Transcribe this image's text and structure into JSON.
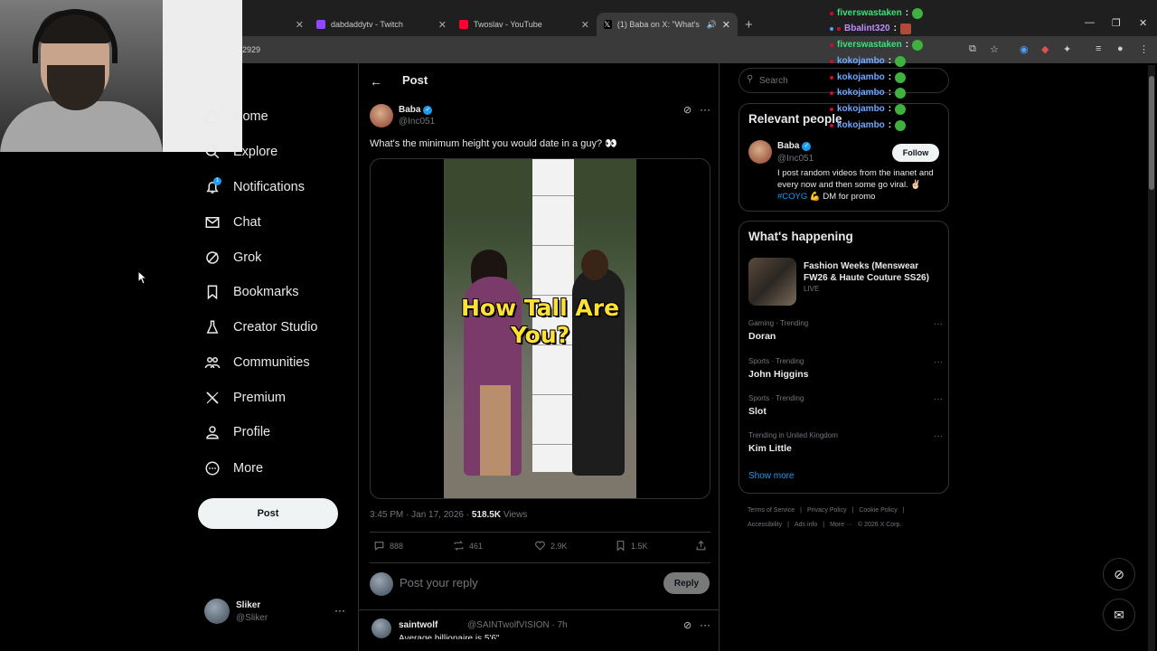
{
  "browser": {
    "tabs": [
      {
        "label": "dabdaddytv - Twitch",
        "color": "#9146ff"
      },
      {
        "label": "Twoslav - YouTube",
        "color": "#ff0033"
      },
      {
        "label": "(1) Baba on X: \"What's the",
        "color": "#ffffff"
      }
    ],
    "url_fragment": "2929"
  },
  "nav": {
    "items": [
      {
        "label": "Home",
        "icon": "home-icon"
      },
      {
        "label": "Explore",
        "icon": "search-icon"
      },
      {
        "label": "Notifications",
        "icon": "bell-icon"
      },
      {
        "label": "Chat",
        "icon": "mail-icon"
      },
      {
        "label": "Grok",
        "icon": "grok-icon"
      },
      {
        "label": "Bookmarks",
        "icon": "bookmark-icon"
      },
      {
        "label": "Creator Studio",
        "icon": "flask-icon"
      },
      {
        "label": "Communities",
        "icon": "people-icon"
      },
      {
        "label": "Premium",
        "icon": "x-logo-icon"
      },
      {
        "label": "Profile",
        "icon": "person-icon"
      },
      {
        "label": "More",
        "icon": "more-circle-icon"
      }
    ],
    "notification_count": "1",
    "post_label": "Post",
    "account": {
      "name": "Sliker",
      "handle": "@Sliker"
    }
  },
  "post": {
    "header": "Post",
    "author": {
      "name": "Baba",
      "handle": "@Inc051"
    },
    "text": "What's the minimum height you would date in a guy? 👀",
    "video_caption": "How Tall Are You?",
    "time": "3:45 PM · Jan 17, 2026 · ",
    "views": "518.5K",
    "views_label": " Views",
    "stats": {
      "replies": "888",
      "reposts": "461",
      "likes": "2.9K",
      "bookmarks": "1.5K"
    },
    "reply_placeholder": "Post your reply",
    "reply_button": "Reply"
  },
  "reply": {
    "name": "saintwolf",
    "handle": "@SAINTwolfVISION · 7h",
    "text": "Average billionaire is 5'6\""
  },
  "sidebar": {
    "search_placeholder": "Search",
    "relevant_title": "Relevant people",
    "person": {
      "name": "Baba",
      "handle": "@Inc051",
      "follow": "Follow",
      "bio_1": "I post random videos from the inanet and every now and then some go viral. ✌🏻",
      "bio_tag": "#COYG",
      "bio_2": " 💪 DM for promo"
    },
    "happening_title": "What's happening",
    "featured": {
      "title": "Fashion Weeks (Menswear FW26 & Haute Couture SS26)",
      "status": "LIVE"
    },
    "trends": [
      {
        "category": "Gaming · Trending",
        "name": "Doran"
      },
      {
        "category": "Sports · Trending",
        "name": "John Higgins"
      },
      {
        "category": "Sports · Trending",
        "name": "Slot"
      },
      {
        "category": "Trending in United Kingdom",
        "name": "Kim Little"
      }
    ],
    "show_more": "Show more",
    "footer_1": [
      "Terms of Service",
      "|",
      "Privacy Policy",
      "|",
      "Cookie Policy",
      "|"
    ],
    "footer_2": [
      "Accessibility",
      "|",
      "Ads info",
      "|",
      "More ···",
      "© 2026 X Corp."
    ]
  },
  "chat": [
    {
      "user": "fiverswastaken",
      "color": "#3fe07a"
    },
    {
      "user": "Bbalint320",
      "color": "#c08bff"
    },
    {
      "user": "fiverswastaken",
      "color": "#3fe07a"
    },
    {
      "user": "kokojambo",
      "color": "#6fa8ff"
    },
    {
      "user": "kokojambo",
      "color": "#6fa8ff"
    },
    {
      "user": "kokojambo",
      "color": "#6fa8ff"
    },
    {
      "user": "kokojambo",
      "color": "#6fa8ff"
    },
    {
      "user": "kokojambo",
      "color": "#6fa8ff"
    }
  ],
  "colors": {
    "accent": "#1d9bf0",
    "background": "#000000",
    "border": "#2f3336"
  }
}
